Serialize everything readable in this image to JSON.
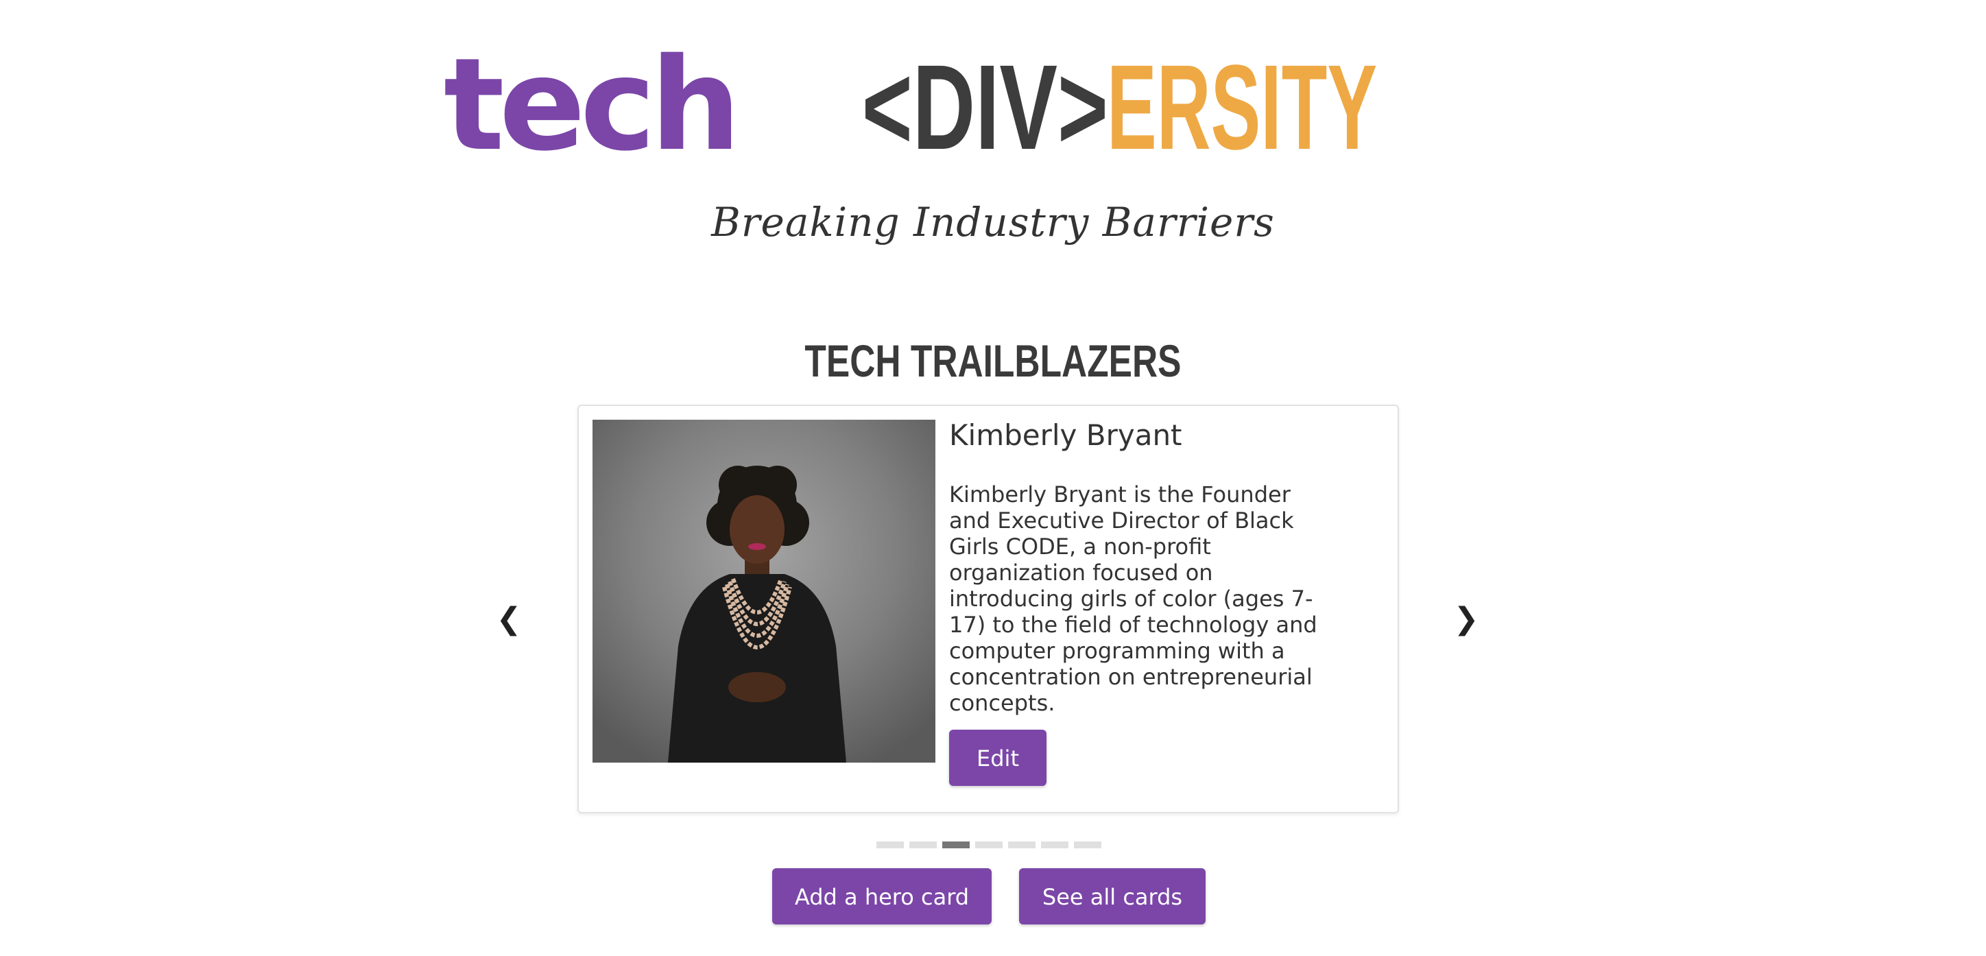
{
  "header": {
    "logo_tech": "tech",
    "logo_div": "<DIV>",
    "logo_ersity": "ERSITY",
    "tagline": "Breaking Industry Barriers"
  },
  "section": {
    "title": "TECH TRAILBLAZERS"
  },
  "carousel": {
    "prev_glyph": "❮",
    "next_glyph": "❯",
    "active_index": 3,
    "indicator_count": 7,
    "card": {
      "name": "Kimberly Bryant",
      "bio": "Kimberly Bryant is the Founder and Executive Director of Black Girls CODE, a non-profit organization focused on introducing girls of color (ages 7-17) to the field of technology and computer programming with a concentration on entrepreneurial concepts.",
      "edit_label": "Edit"
    }
  },
  "actions": {
    "add_label": "Add a hero card",
    "see_all_label": "See all cards"
  },
  "colors": {
    "brand_purple": "#7b46a8",
    "brand_orange": "#eea945",
    "brand_dark": "#3d3d3d"
  },
  "icons": {
    "prev": "chevron-left-icon",
    "next": "chevron-right-icon"
  }
}
